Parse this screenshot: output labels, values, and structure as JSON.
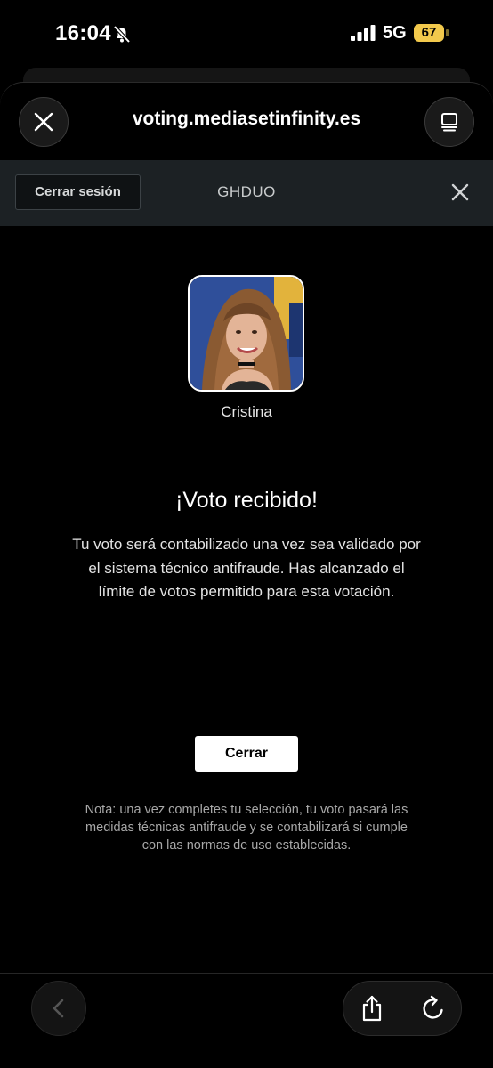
{
  "status_bar": {
    "time": "16:04",
    "network": "5G",
    "battery": "67"
  },
  "browser": {
    "url": "voting.mediasetinfinity.es"
  },
  "top_bar": {
    "logout_label": "Cerrar sesión",
    "code": "GHDUO"
  },
  "candidate": {
    "name": "Cristina"
  },
  "result": {
    "heading": "¡Voto recibido!",
    "message": "Tu voto será contabilizado una vez sea validado por el sistema técnico antifraude. Has alcanzado el límite de votos permitido para esta votación.",
    "close_label": "Cerrar",
    "note": "Nota: una vez completes tu selección, tu voto pasará las medidas técnicas antifraude y se contabilizará si cumple con las normas de uso establecidas."
  },
  "colors": {
    "background": "#000000",
    "top_bar": "#1c2124",
    "battery": "#f2c94c",
    "button": "#ffffff"
  },
  "icons": [
    "bell-slash-icon",
    "signal-icon",
    "battery-icon",
    "close-icon",
    "tabs-icon",
    "chevron-left-icon",
    "share-icon",
    "reload-icon"
  ]
}
